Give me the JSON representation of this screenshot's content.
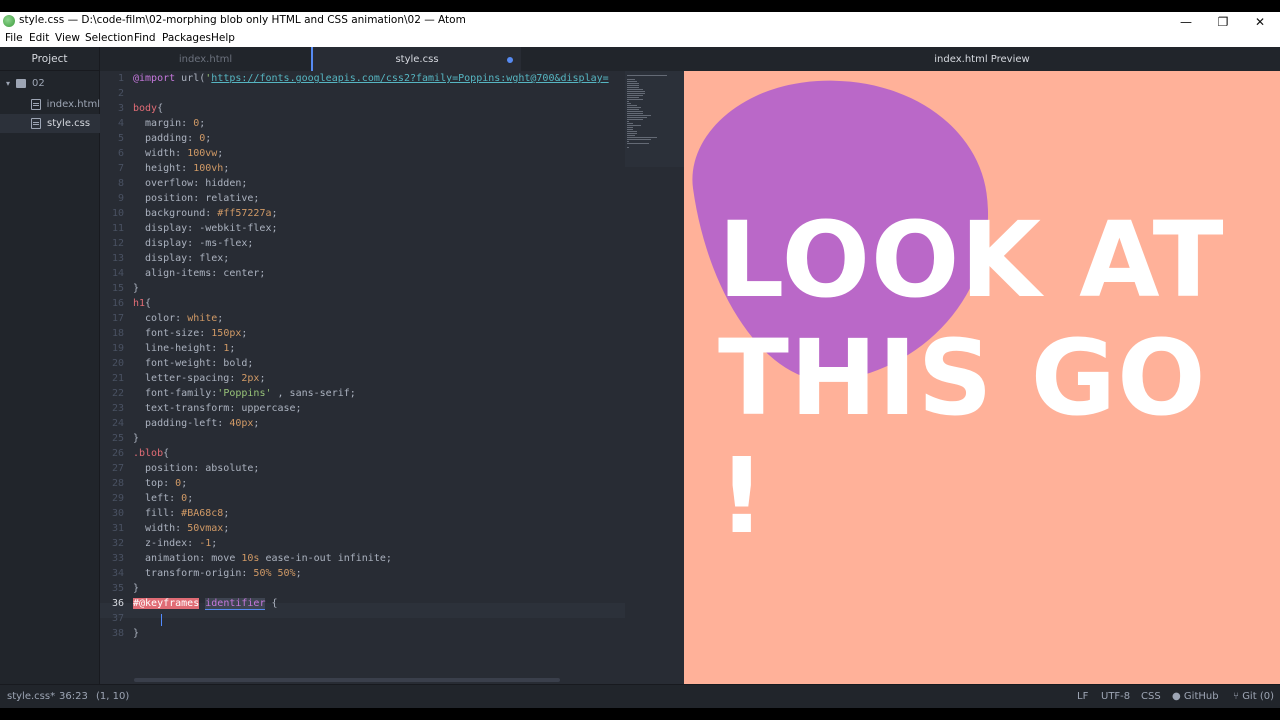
{
  "window": {
    "title": "style.css — D:\\code-film\\02-morphing blob only HTML and CSS animation\\02 — Atom",
    "minimize": "—",
    "maximize": "❐",
    "close": "✕"
  },
  "menu": [
    "File",
    "Edit",
    "View",
    "Selection",
    "Find",
    "Packages",
    "Help"
  ],
  "tree": {
    "header": "Project",
    "folder": "02",
    "files": [
      "index.html",
      "style.css"
    ],
    "selected": "style.css"
  },
  "tabs": {
    "inactive": "index.html",
    "active": "style.css",
    "preview": "index.html Preview"
  },
  "code": {
    "line_numbers": [
      "1",
      "2",
      "3",
      "4",
      "5",
      "6",
      "7",
      "8",
      "9",
      "10",
      "11",
      "12",
      "13",
      "14",
      "15",
      "16",
      "17",
      "18",
      "19",
      "20",
      "21",
      "22",
      "23",
      "24",
      "25",
      "26",
      "27",
      "28",
      "29",
      "30",
      "31",
      "32",
      "33",
      "34",
      "35",
      "36",
      "37",
      "38"
    ],
    "current_line": "36"
  },
  "preview": {
    "headline": "LOOK AT THIS GO !",
    "background": "#ffb199",
    "blob_color": "#BA68C8"
  },
  "status": {
    "file": "style.css*",
    "position": "36:23",
    "selection": "(1, 10)",
    "line_ending": "LF",
    "encoding": "UTF-8",
    "grammar": "CSS",
    "github": "GitHub",
    "git": "Git (0)"
  },
  "colors": {
    "accent": "#568af2",
    "editor_bg": "#282c34",
    "panel_bg": "#21252b"
  }
}
